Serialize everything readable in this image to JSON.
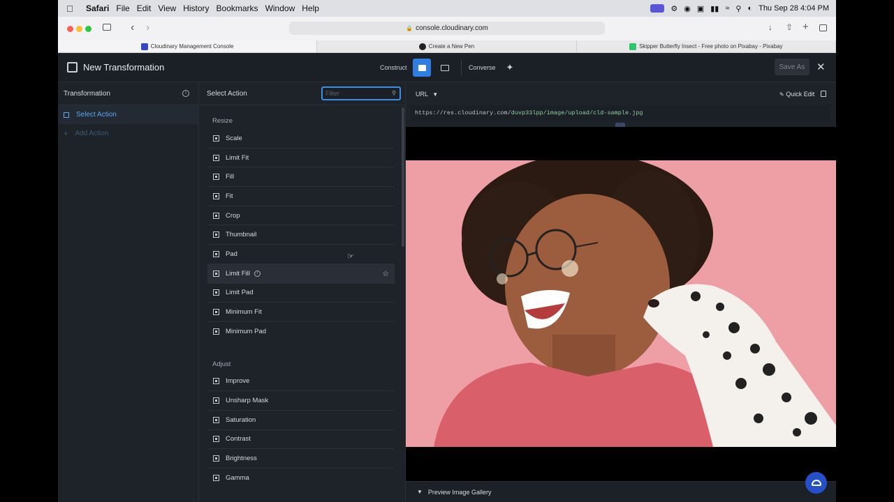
{
  "menubar": {
    "app": "Safari",
    "items": [
      "File",
      "Edit",
      "View",
      "History",
      "Bookmarks",
      "Window",
      "Help"
    ],
    "clock": "Thu Sep 28  4:04 PM"
  },
  "browser": {
    "url": "console.cloudinary.com",
    "tabs": [
      {
        "label": "Cloudinary Management Console",
        "favicon_color": "#3448c5"
      },
      {
        "label": "Create a New Pen",
        "favicon_color": "#222222"
      },
      {
        "label": "Skipper Butterfly Insect - Free photo on Pixabay - Pixabay",
        "favicon_color": "#2ec66d"
      }
    ]
  },
  "header": {
    "title": "New Transformation",
    "construct_label": "Construct",
    "converse_label": "Converse",
    "save_as_label": "Save As"
  },
  "left": {
    "title": "Transformation",
    "selected_item": "Select Action",
    "add_item": "Add Action"
  },
  "middle": {
    "title": "Select Action",
    "filter_placeholder": "Filter",
    "sections": [
      {
        "label": "Resize",
        "items": [
          "Scale",
          "Limit Fit",
          "Fill",
          "Fit",
          "Crop",
          "Thumbnail",
          "Pad",
          "Limit Fill",
          "Limit Pad",
          "Minimum Fit",
          "Minimum Pad"
        ]
      },
      {
        "label": "Adjust",
        "items": [
          "Improve",
          "Unsharp Mask",
          "Saturation",
          "Contrast",
          "Brightness",
          "Gamma"
        ]
      }
    ],
    "hover_item": "Limit Fill"
  },
  "right": {
    "format_label": "URL",
    "quick_edit_label": "Quick Edit",
    "url_prefix": "https://res.cloudinary.com/",
    "url_path": "duvp33lpp/image/upload/cld-sample.jpg",
    "gallery_label": "Preview Image Gallery"
  },
  "colors": {
    "accent": "#3d8ee6",
    "photo_bg": "#ef9fa6",
    "sweater": "#d9606b"
  }
}
